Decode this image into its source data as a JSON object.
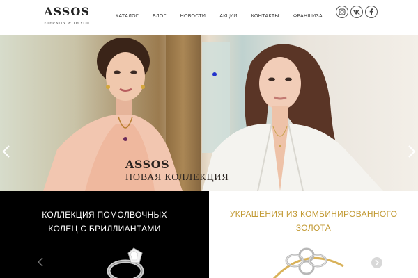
{
  "header": {
    "logo_title": "ASSOS",
    "logo_tagline": "ETERNITY WITH YOU",
    "nav": [
      "КАТАЛОГ",
      "БЛОГ",
      "НОВОСТИ",
      "АКЦИИ",
      "КОНТАКТЫ",
      "ФРАНШИЗА"
    ],
    "socials": [
      "instagram-icon",
      "vk-icon",
      "facebook-icon"
    ]
  },
  "hero": {
    "title": "ASSOS",
    "subtitle": "НОВАЯ КОЛЛЕКЦИЯ",
    "active_dot_color": "#2233cc"
  },
  "panels": {
    "left_title": "КОЛЛЕКЦИЯ ПОМОЛВОЧНЫХ КОЛЕЦ С БРИЛЛИАНТАМИ",
    "right_title": "УКРАШЕНИЯ ИЗ КОМБИНИРОВАННОГО ЗОЛОТА",
    "accent_color": "#c29a34"
  }
}
